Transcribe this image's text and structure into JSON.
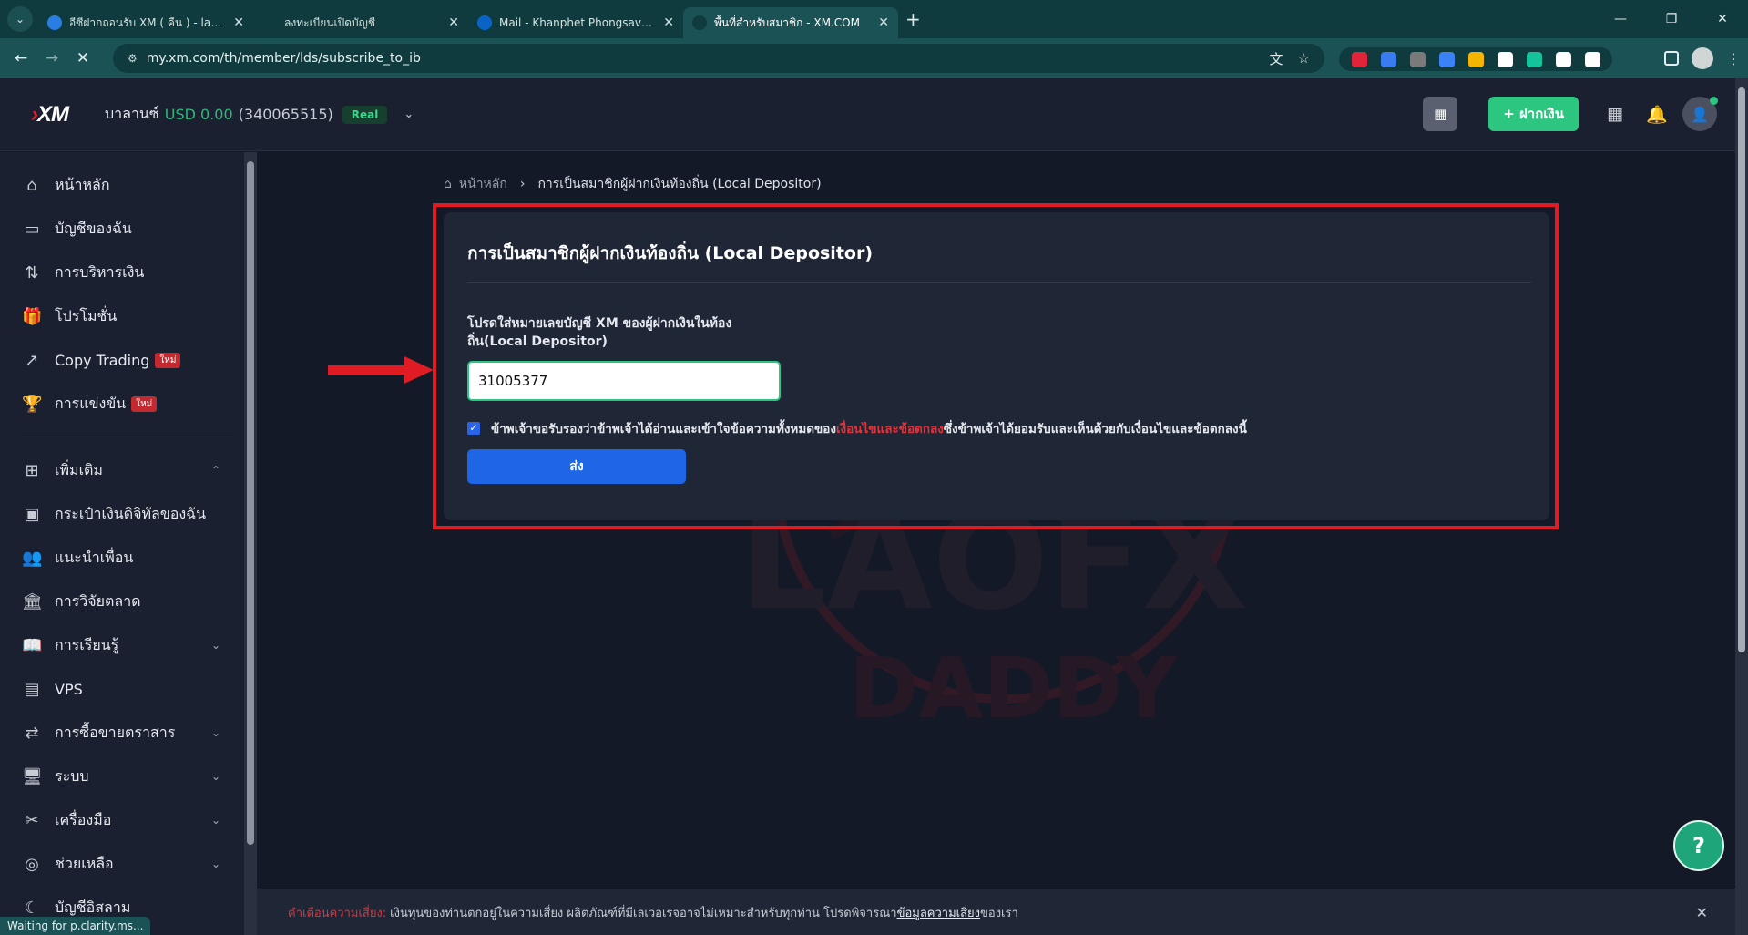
{
  "browser": {
    "tabs": [
      {
        "title": "อีซีฝากถอนรับ XM ( คืน ) - laofxdad",
        "favicon_color": "#2a7de1",
        "active": false
      },
      {
        "title": "ลงทะเบียนเปิดบัญชี",
        "favicon_color": "#0f3b3e",
        "active": false
      },
      {
        "title": "Mail - Khanphet Phongsavath -",
        "favicon_color": "#0a64c8",
        "active": false
      },
      {
        "title": "พื้นที่สำหรับสมาชิก - XM.COM",
        "favicon_color": "#0f3b3e",
        "active": true
      }
    ],
    "url": "my.xm.com/th/member/lds/subscribe_to_ib",
    "status_text": "Waiting for p.clarity.ms...",
    "extension_colors": [
      "#e0243a",
      "#3a7bf2",
      "#7a7a7a",
      "#3b82f6",
      "#f4b400",
      "#ffffff",
      "#15c39a",
      "#ffffff",
      "#ffffff"
    ]
  },
  "header": {
    "logo": "XM",
    "balance_label": "บาลานซ์",
    "balance_amount": "USD 0.00",
    "account_number": "(340065515)",
    "account_type": "Real",
    "deposit_button": "+ ฝากเงิน"
  },
  "sidebar": {
    "items": [
      {
        "label": "หน้าหลัก",
        "icon": "home-icon",
        "glyph": "⌂"
      },
      {
        "label": "บัญชีของฉัน",
        "icon": "wallet-card-icon",
        "glyph": "▭"
      },
      {
        "label": "การบริหารเงิน",
        "icon": "transfer-arrows-icon",
        "glyph": "⇅"
      },
      {
        "label": "โปรโมชั่น",
        "icon": "gift-icon",
        "glyph": "🎁"
      },
      {
        "label": "Copy Trading",
        "icon": "trend-up-icon",
        "glyph": "↗",
        "badge": "ใหม่"
      },
      {
        "label": "การแข่งขัน",
        "icon": "trophy-icon",
        "glyph": "🏆",
        "badge": "ใหม่"
      }
    ],
    "more_label": "เพิ่มเติม",
    "more_items": [
      {
        "label": "กระเป๋าเงินดิจิทัลของฉัน",
        "icon": "digital-wallet-icon",
        "glyph": "▣",
        "chevron": false
      },
      {
        "label": "แนะนำเพื่อน",
        "icon": "refer-friends-icon",
        "glyph": "👥",
        "chevron": false
      },
      {
        "label": "การวิจัยตลาด",
        "icon": "bank-icon",
        "glyph": "🏛",
        "chevron": false
      },
      {
        "label": "การเรียนรู้",
        "icon": "book-icon",
        "glyph": "📖",
        "chevron": true
      },
      {
        "label": "VPS",
        "icon": "server-icon",
        "glyph": "▤",
        "chevron": false
      },
      {
        "label": "การซื้อขายตราสาร",
        "icon": "swap-icon",
        "glyph": "⇄",
        "chevron": true
      },
      {
        "label": "ระบบ",
        "icon": "monitor-icon",
        "glyph": "🖥",
        "chevron": true
      },
      {
        "label": "เครื่องมือ",
        "icon": "tools-icon",
        "glyph": "✂",
        "chevron": true
      },
      {
        "label": "ช่วยเหลือ",
        "icon": "lifebuoy-icon",
        "glyph": "◎",
        "chevron": true
      },
      {
        "label": "บัญชีอิสลาม",
        "icon": "crescent-icon",
        "glyph": "☾",
        "chevron": false
      }
    ]
  },
  "breadcrumb": {
    "home": "หน้าหลัก",
    "current": "การเป็นสมาชิกผู้ฝากเงินท้องถิ่น (Local Depositor)"
  },
  "form": {
    "title": "การเป็นสมาชิกผู้ฝากเงินท้องถิ่น (Local Depositor)",
    "field_label": "โปรดใส่หมายเลขบัญชี XM ของผู้ฝากเงินในท้องถิ่น(Local Depositor)",
    "field_value": "31005377",
    "agree_prefix": "ข้าพเจ้าขอรับรองว่าข้าพเจ้าได้อ่านและเข้าใจข้อความทั้งหมดของ",
    "agree_link": "เงื่อนไขและข้อตกลง",
    "agree_suffix": "ซึ่งข้าพเจ้าได้ยอมรับและเห็นด้วยกับเงื่อนไขและข้อตกลงนี้",
    "agree_checked": true,
    "submit_label": "ส่ง"
  },
  "risk_bar": {
    "warning_label": "คำเตือนความเสี่ยง:",
    "text": "เงินทุนของท่านตกอยู่ในความเสี่ยง ผลิตภัณฑ์ที่มีเลเวอเรจอาจไม่เหมาะสำหรับทุกท่าน โปรดพิจารณา",
    "link": "ข้อมูลความเสี่ยง",
    "suffix": "ของเรา"
  },
  "watermark_text": {
    "line1": "LAOFX",
    "line2": "DADDY"
  },
  "colors": {
    "accent_green": "#2cc680",
    "primary_blue": "#1f66e6",
    "highlight_red": "#e01b24"
  }
}
